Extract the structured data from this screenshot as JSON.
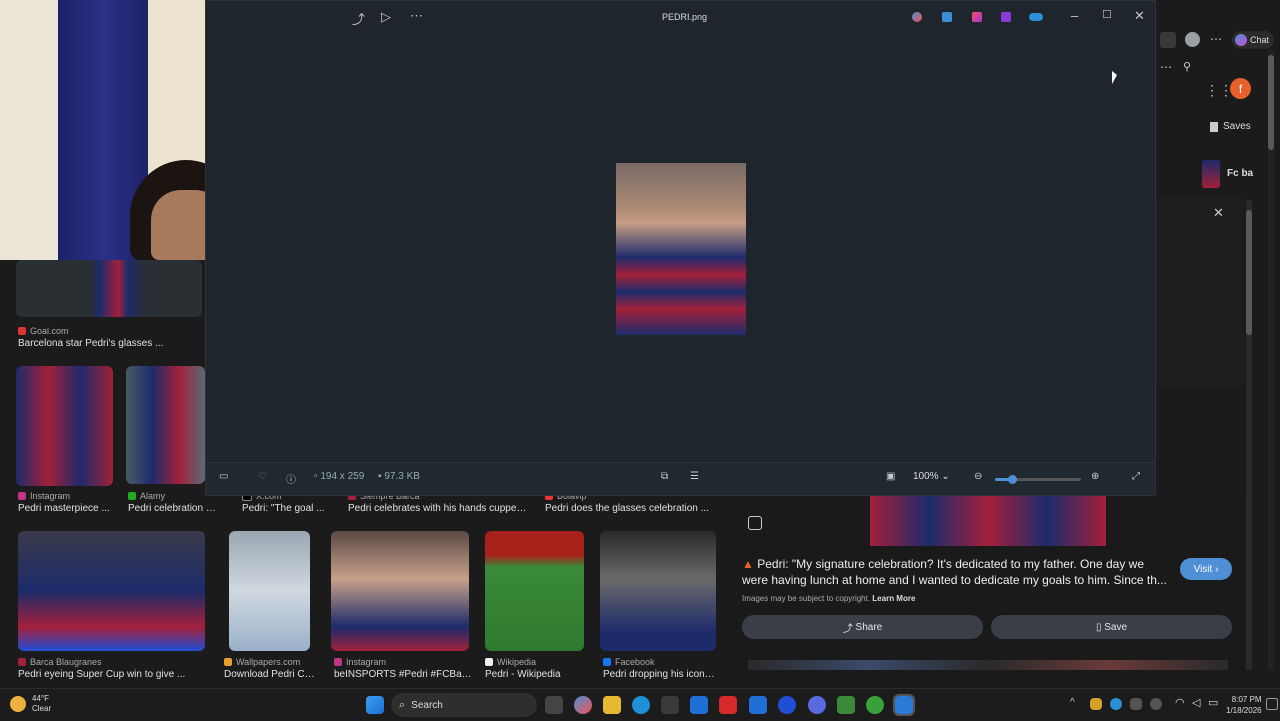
{
  "photos": {
    "title": "PEDRI.png",
    "dimensions": "194 x 259",
    "filesize": "97.3 KB",
    "zoom": "100%",
    "zoom_level": 0.2
  },
  "results": [
    {
      "source": "Goal.com",
      "caption": "Barcelona star Pedri's glasses ..."
    },
    {
      "source": "Instagram",
      "caption": "Pedri masterpiece ..."
    },
    {
      "source": "Alamy",
      "caption": "Pedri celebration hi-..."
    },
    {
      "source": "X.com",
      "caption": "Pedri: \"The goal ..."
    },
    {
      "source": "Siempre Barca",
      "caption": "Pedri celebrates with his hands cupped ..."
    },
    {
      "source": "Bolavip",
      "caption": "Pedri does the glasses celebration ..."
    },
    {
      "source": "Barca Blaugranes",
      "caption": "Pedri eyeing Super Cup win to give ..."
    },
    {
      "source": "Wallpapers.com",
      "caption": "Download Pedri Cel..."
    },
    {
      "source": "Instagram",
      "caption": "beINSPORTS #Pedri #FCBarc..."
    },
    {
      "source": "Wikipedia",
      "caption": "Pedri - Wikipedia"
    },
    {
      "source": "Facebook",
      "caption": "Pedri dropping his iconi..."
    }
  ],
  "browser": {
    "chat_label": "Chat",
    "saves_label": "Saves",
    "fc_label": "Fc ba",
    "avatar_letter": "f"
  },
  "detail": {
    "quote": "Pedri: \"My signature celebration? It's dedicated to my father. One day we were having lunch at home and I wanted to dedicate my goals to him. Since th...",
    "copyright": "Images may be subject to copyright.",
    "learn_more": "Learn More",
    "visit_label": "Visit",
    "share_label": "Share",
    "save_label": "Save"
  },
  "taskbar": {
    "weather_temp": "44°F",
    "weather_desc": "Clear",
    "search_label": "Search",
    "time": "8:07 PM",
    "date": "1/18/2026"
  },
  "colors": {
    "accent": "#4f8fd6",
    "photos_bg": "#1e252c",
    "barca_blue": "#1d2b6b",
    "barca_red": "#a3203a"
  }
}
